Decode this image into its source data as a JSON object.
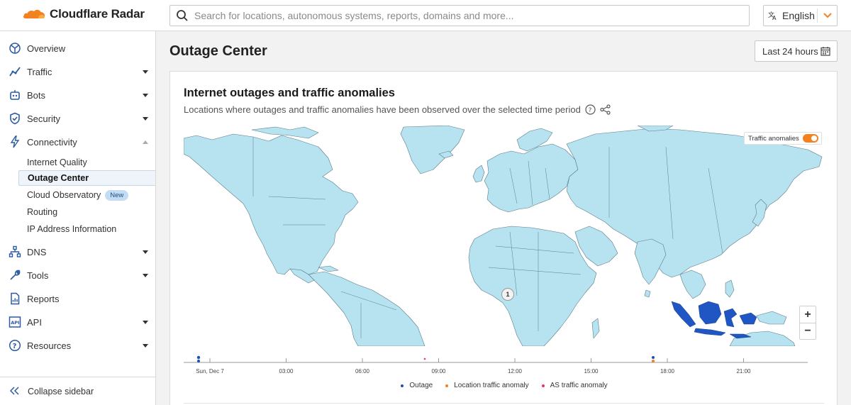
{
  "header": {
    "brand": "Cloudflare Radar",
    "search_placeholder": "Search for locations, autonomous systems, reports, domains and more...",
    "language": "English"
  },
  "sidebar": {
    "items": [
      {
        "label": "Overview",
        "icon": "overview-icon"
      },
      {
        "label": "Traffic",
        "icon": "traffic-icon"
      },
      {
        "label": "Bots",
        "icon": "bot-icon"
      },
      {
        "label": "Security",
        "icon": "shield-icon"
      },
      {
        "label": "Connectivity",
        "icon": "lightning-icon"
      },
      {
        "label": "DNS",
        "icon": "dns-icon"
      },
      {
        "label": "Tools",
        "icon": "wrench-icon"
      },
      {
        "label": "Reports",
        "icon": "report-icon"
      },
      {
        "label": "API",
        "icon": "api-icon"
      },
      {
        "label": "Resources",
        "icon": "help-icon"
      }
    ],
    "connectivity_sub": [
      {
        "label": "Internet Quality"
      },
      {
        "label": "Outage Center"
      },
      {
        "label": "Cloud Observatory",
        "badge": "New"
      },
      {
        "label": "Routing"
      },
      {
        "label": "IP Address Information"
      }
    ],
    "collapse_label": "Collapse sidebar"
  },
  "main": {
    "page_title": "Outage Center",
    "time_range": "Last 24 hours"
  },
  "card": {
    "title": "Internet outages and traffic anomalies",
    "subtitle": "Locations where outages and traffic anomalies have been observed over the selected time period",
    "toggle_label": "Traffic anomalies",
    "toggle_on": true,
    "cluster_count": "1",
    "zoom_in": "+",
    "zoom_out": "−"
  },
  "timeline": {
    "ticks": [
      "Sun, Dec 7",
      "03:00",
      "06:00",
      "09:00",
      "12:00",
      "15:00",
      "18:00",
      "21:00"
    ],
    "legend": [
      {
        "label": "Outage",
        "color": "#1f4fb4"
      },
      {
        "label": "Location traffic anomaly",
        "color": "#f48120"
      },
      {
        "label": "AS traffic anomaly",
        "color": "#e8336d"
      }
    ]
  },
  "colors": {
    "accent": "#f48120",
    "map_land": "#b7e2f0",
    "map_highlight": "#1f56c4",
    "map_border": "#5a7d8a"
  }
}
